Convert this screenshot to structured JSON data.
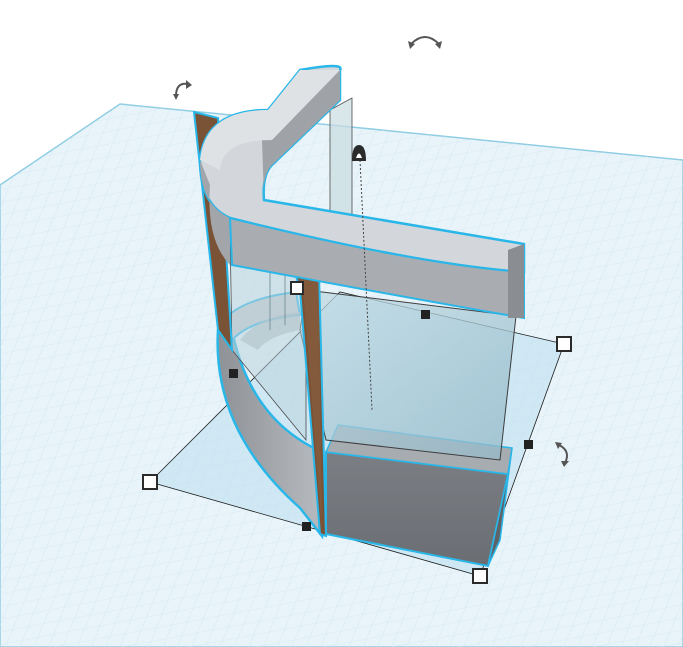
{
  "viewport": {
    "name": "3d-workplane-view"
  },
  "colors": {
    "background": "#ffffff",
    "workplane": "#e8f4f9",
    "grid_line": "#cfe6f0",
    "grid_major": "#b4d8e6",
    "workplane_edge": "#8fcde3",
    "selection_outline": "#29b6e8",
    "shape_top": "#d3d6da",
    "shape_side": "#9fa3a8",
    "shape_dark": "#7f8388",
    "glass": "#a9c9d6",
    "brown": "#7a5236",
    "footprint": "#b9dff0",
    "handle_fill": "#ffffff",
    "handle_stroke": "#2b2b2b",
    "arrow": "#555555"
  },
  "icons": {
    "rotate_top": "curved-double-arrow-icon",
    "rotate_left": "curved-arrow-icon",
    "rotate_right": "curved-arrow-icon",
    "height_handle": "cone-lift-icon"
  }
}
